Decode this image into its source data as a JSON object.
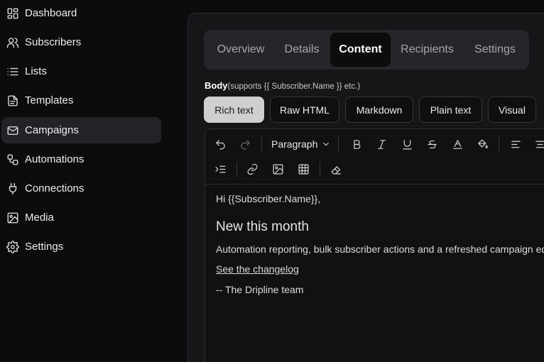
{
  "sidebar": {
    "items": [
      {
        "label": "Dashboard",
        "icon": "dashboard-icon"
      },
      {
        "label": "Subscribers",
        "icon": "users-icon"
      },
      {
        "label": "Lists",
        "icon": "list-icon"
      },
      {
        "label": "Templates",
        "icon": "file-icon"
      },
      {
        "label": "Campaigns",
        "icon": "mail-icon",
        "active": true
      },
      {
        "label": "Automations",
        "icon": "workflow-icon"
      },
      {
        "label": "Connections",
        "icon": "plug-icon"
      },
      {
        "label": "Media",
        "icon": "image-icon"
      },
      {
        "label": "Settings",
        "icon": "gear-icon"
      }
    ]
  },
  "tabs": [
    "Overview",
    "Details",
    "Content",
    "Recipients",
    "Settings"
  ],
  "active_tab": "Content",
  "body": {
    "label": "Body",
    "hint": "(supports {{ Subscriber.Name }} etc.)"
  },
  "formats": [
    "Rich text",
    "Raw HTML",
    "Markdown",
    "Plain text",
    "Visual"
  ],
  "active_format": "Rich text",
  "toolbar": {
    "block_type": "Paragraph"
  },
  "content": {
    "greeting": "Hi {{Subscriber.Name}},",
    "heading": "New this month",
    "paragraph": "Automation reporting, bulk subscriber actions and a refreshed campaign edit",
    "link": "See the changelog",
    "signoff": "-- The Dripline team"
  }
}
